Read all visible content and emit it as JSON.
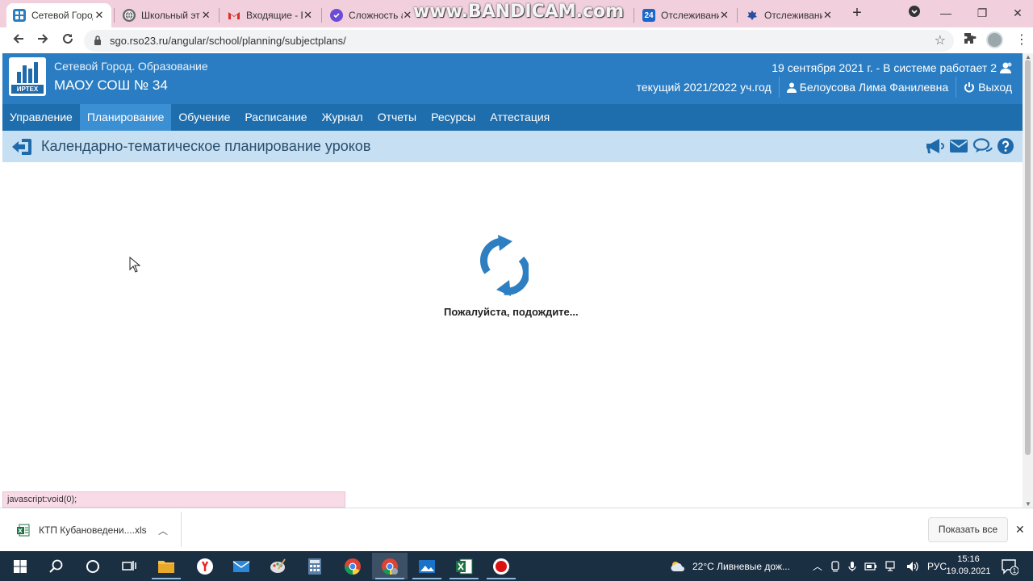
{
  "browser": {
    "tabs": [
      {
        "title": "Сетевой Город",
        "active": true,
        "icon": "sgo-icon",
        "color": "#2a7dc2"
      },
      {
        "title": "Школьный эт",
        "active": false,
        "icon": "globe-icon",
        "color": "#555555"
      },
      {
        "title": "Входящие - E",
        "active": false,
        "icon": "gmail-icon",
        "color": "#d93025"
      },
      {
        "title": "Сложность а",
        "active": false,
        "icon": "shield-icon",
        "color": "#6a4cd6"
      },
      {
        "title": "",
        "active": false,
        "icon": "blank-icon",
        "color": "#888888"
      },
      {
        "title": "Отслеживани",
        "active": false,
        "icon": "24-icon",
        "color": "#1b66c9"
      },
      {
        "title": "Отслеживани",
        "active": false,
        "icon": "emblem-icon",
        "color": "#2a4fa0"
      }
    ],
    "watermark": "www.BANDICAM.com",
    "url": "sgo.rso23.ru/angular/school/planning/subjectplans/",
    "status_url": "javascript:void(0);"
  },
  "header": {
    "logo_caption": "ИРТЕХ",
    "brand_subtitle": "Сетевой Город. Образование",
    "school": "МАОУ СОШ № 34",
    "date_line": "19 сентября 2021 г. - В системе работает 2",
    "year": "текущий 2021/2022 уч.год",
    "user": "Белоусова Лима Фанилевна",
    "logout": "Выход"
  },
  "nav": {
    "items": [
      "Управление",
      "Планирование",
      "Обучение",
      "Расписание",
      "Журнал",
      "Отчеты",
      "Ресурсы",
      "Аттестация"
    ],
    "active_index": 1
  },
  "page": {
    "title": "Календарно-тематическое планирование уроков",
    "loading_text": "Пожалуйста, подождите..."
  },
  "downloads": {
    "file": "КТП Кубановедени....xls",
    "show_all": "Показать все"
  },
  "taskbar": {
    "weather": "22°C  Ливневые дож...",
    "lang": "РУС",
    "time": "15:16",
    "date": "19.09.2021",
    "notifications": "1"
  },
  "colors": {
    "header_blue": "#2a7dc2",
    "nav_blue": "#1e6ead",
    "nav_active": "#3b8fd3",
    "titlebar": "#c6dff2",
    "spinner": "#2e7fc1"
  }
}
